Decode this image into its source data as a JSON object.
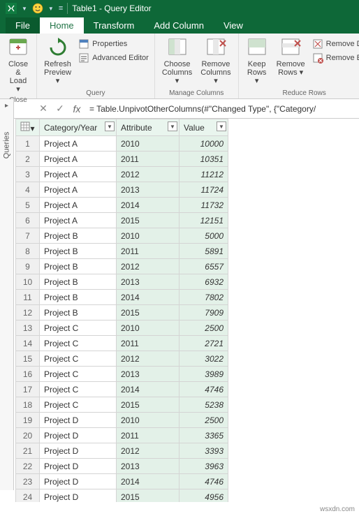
{
  "titlebar": {
    "app_title": "Table1 - Query Editor"
  },
  "tabs": {
    "file": "File",
    "home": "Home",
    "transform": "Transform",
    "add_column": "Add Column",
    "view": "View"
  },
  "ribbon": {
    "close_load": "Close &\nLoad ▾",
    "close_group": "Close",
    "refresh": "Refresh\nPreview ▾",
    "properties": "Properties",
    "advanced": "Advanced Editor",
    "query_group": "Query",
    "choose_cols": "Choose\nColumns ▾",
    "remove_cols": "Remove\nColumns ▾",
    "manage_cols_group": "Manage Columns",
    "keep_rows": "Keep\nRows ▾",
    "remove_rows": "Remove\nRows ▾",
    "remove_d": "Remove D",
    "remove_er": "Remove Er",
    "reduce_rows_group": "Reduce Rows"
  },
  "formula_bar": {
    "formula": "= Table.UnpivotOtherColumns(#\"Changed Type\", {\"Category/"
  },
  "sidebar": {
    "label": "Queries"
  },
  "grid": {
    "headers": [
      "Category/Year",
      "Attribute",
      "Value"
    ],
    "rows": [
      {
        "n": 1,
        "cat": "Project A",
        "attr": "2010",
        "val": "10000"
      },
      {
        "n": 2,
        "cat": "Project A",
        "attr": "2011",
        "val": "10351"
      },
      {
        "n": 3,
        "cat": "Project A",
        "attr": "2012",
        "val": "11212"
      },
      {
        "n": 4,
        "cat": "Project A",
        "attr": "2013",
        "val": "11724"
      },
      {
        "n": 5,
        "cat": "Project A",
        "attr": "2014",
        "val": "11732"
      },
      {
        "n": 6,
        "cat": "Project A",
        "attr": "2015",
        "val": "12151"
      },
      {
        "n": 7,
        "cat": "Project B",
        "attr": "2010",
        "val": "5000"
      },
      {
        "n": 8,
        "cat": "Project B",
        "attr": "2011",
        "val": "5891"
      },
      {
        "n": 9,
        "cat": "Project B",
        "attr": "2012",
        "val": "6557"
      },
      {
        "n": 10,
        "cat": "Project B",
        "attr": "2013",
        "val": "6932"
      },
      {
        "n": 11,
        "cat": "Project B",
        "attr": "2014",
        "val": "7802"
      },
      {
        "n": 12,
        "cat": "Project B",
        "attr": "2015",
        "val": "7909"
      },
      {
        "n": 13,
        "cat": "Project C",
        "attr": "2010",
        "val": "2500"
      },
      {
        "n": 14,
        "cat": "Project C",
        "attr": "2011",
        "val": "2721"
      },
      {
        "n": 15,
        "cat": "Project C",
        "attr": "2012",
        "val": "3022"
      },
      {
        "n": 16,
        "cat": "Project C",
        "attr": "2013",
        "val": "3989"
      },
      {
        "n": 17,
        "cat": "Project C",
        "attr": "2014",
        "val": "4746"
      },
      {
        "n": 18,
        "cat": "Project C",
        "attr": "2015",
        "val": "5238"
      },
      {
        "n": 19,
        "cat": "Project D",
        "attr": "2010",
        "val": "2500"
      },
      {
        "n": 20,
        "cat": "Project D",
        "attr": "2011",
        "val": "3365"
      },
      {
        "n": 21,
        "cat": "Project D",
        "attr": "2012",
        "val": "3393"
      },
      {
        "n": 22,
        "cat": "Project D",
        "attr": "2013",
        "val": "3963"
      },
      {
        "n": 23,
        "cat": "Project D",
        "attr": "2014",
        "val": "4746"
      },
      {
        "n": 24,
        "cat": "Project D",
        "attr": "2015",
        "val": "4956"
      }
    ]
  },
  "watermark": "wsxdn.com"
}
